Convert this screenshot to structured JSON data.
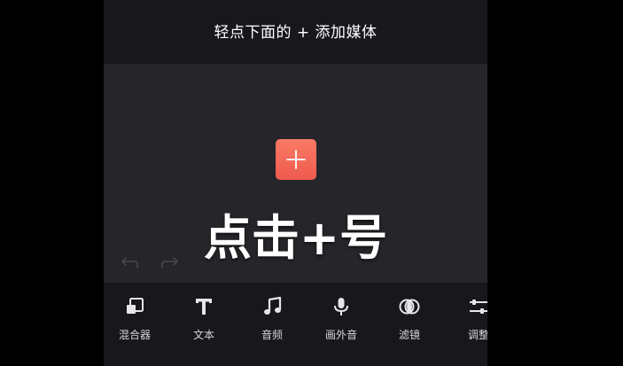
{
  "hint": {
    "text": "轻点下面的 + 添加媒体"
  },
  "preview": {
    "add_button": {
      "icon": "plus-icon",
      "color": "#f4685a"
    },
    "caption": "点击+号"
  },
  "history": {
    "undo_icon": "undo-arrow-icon",
    "redo_icon": "redo-arrow-icon"
  },
  "toolbar": {
    "items": [
      {
        "label": "混合器",
        "icon": "mixer-icon"
      },
      {
        "label": "文本",
        "icon": "text-icon"
      },
      {
        "label": "音频",
        "icon": "music-note-icon"
      },
      {
        "label": "画外音",
        "icon": "microphone-icon"
      },
      {
        "label": "滤镜",
        "icon": "filter-icon"
      },
      {
        "label": "调整",
        "icon": "adjust-sliders-icon"
      }
    ]
  }
}
